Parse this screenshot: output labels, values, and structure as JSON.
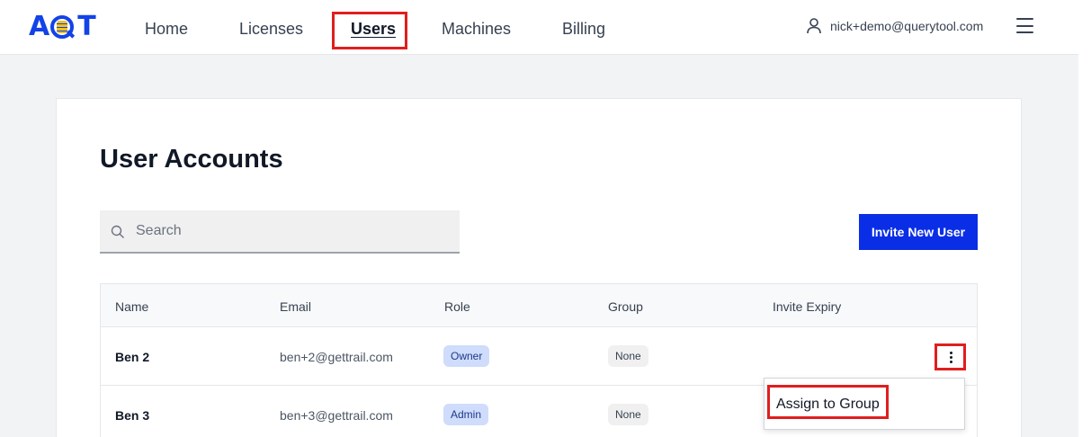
{
  "brand": {
    "logo_prefix": "A",
    "logo_suffix": "T"
  },
  "nav": {
    "links": [
      {
        "label": "Home"
      },
      {
        "label": "Licenses"
      },
      {
        "label": "Users"
      },
      {
        "label": "Machines"
      },
      {
        "label": "Billing"
      }
    ],
    "active": "Users",
    "user_email": "nick+demo@querytool.com"
  },
  "page": {
    "title": "User Accounts",
    "search_placeholder": "Search",
    "invite_button": "Invite New User"
  },
  "table": {
    "columns": [
      "Name",
      "Email",
      "Role",
      "Group",
      "Invite Expiry"
    ],
    "rows": [
      {
        "name": "Ben 2",
        "email": "ben+2@gettrail.com",
        "role": "Owner",
        "group": "None",
        "invite_expiry": ""
      },
      {
        "name": "Ben 3",
        "email": "ben+3@gettrail.com",
        "role": "Admin",
        "group": "None",
        "invite_expiry": ""
      }
    ]
  },
  "row_menu": {
    "items": [
      {
        "label": "Assign to Group"
      }
    ]
  },
  "colors": {
    "brand": "#1242e8",
    "accent": "#f2c21b",
    "primary_button": "#0a2ee6",
    "highlight": "#e01e1e",
    "role_badge": "#cfdcfb"
  }
}
